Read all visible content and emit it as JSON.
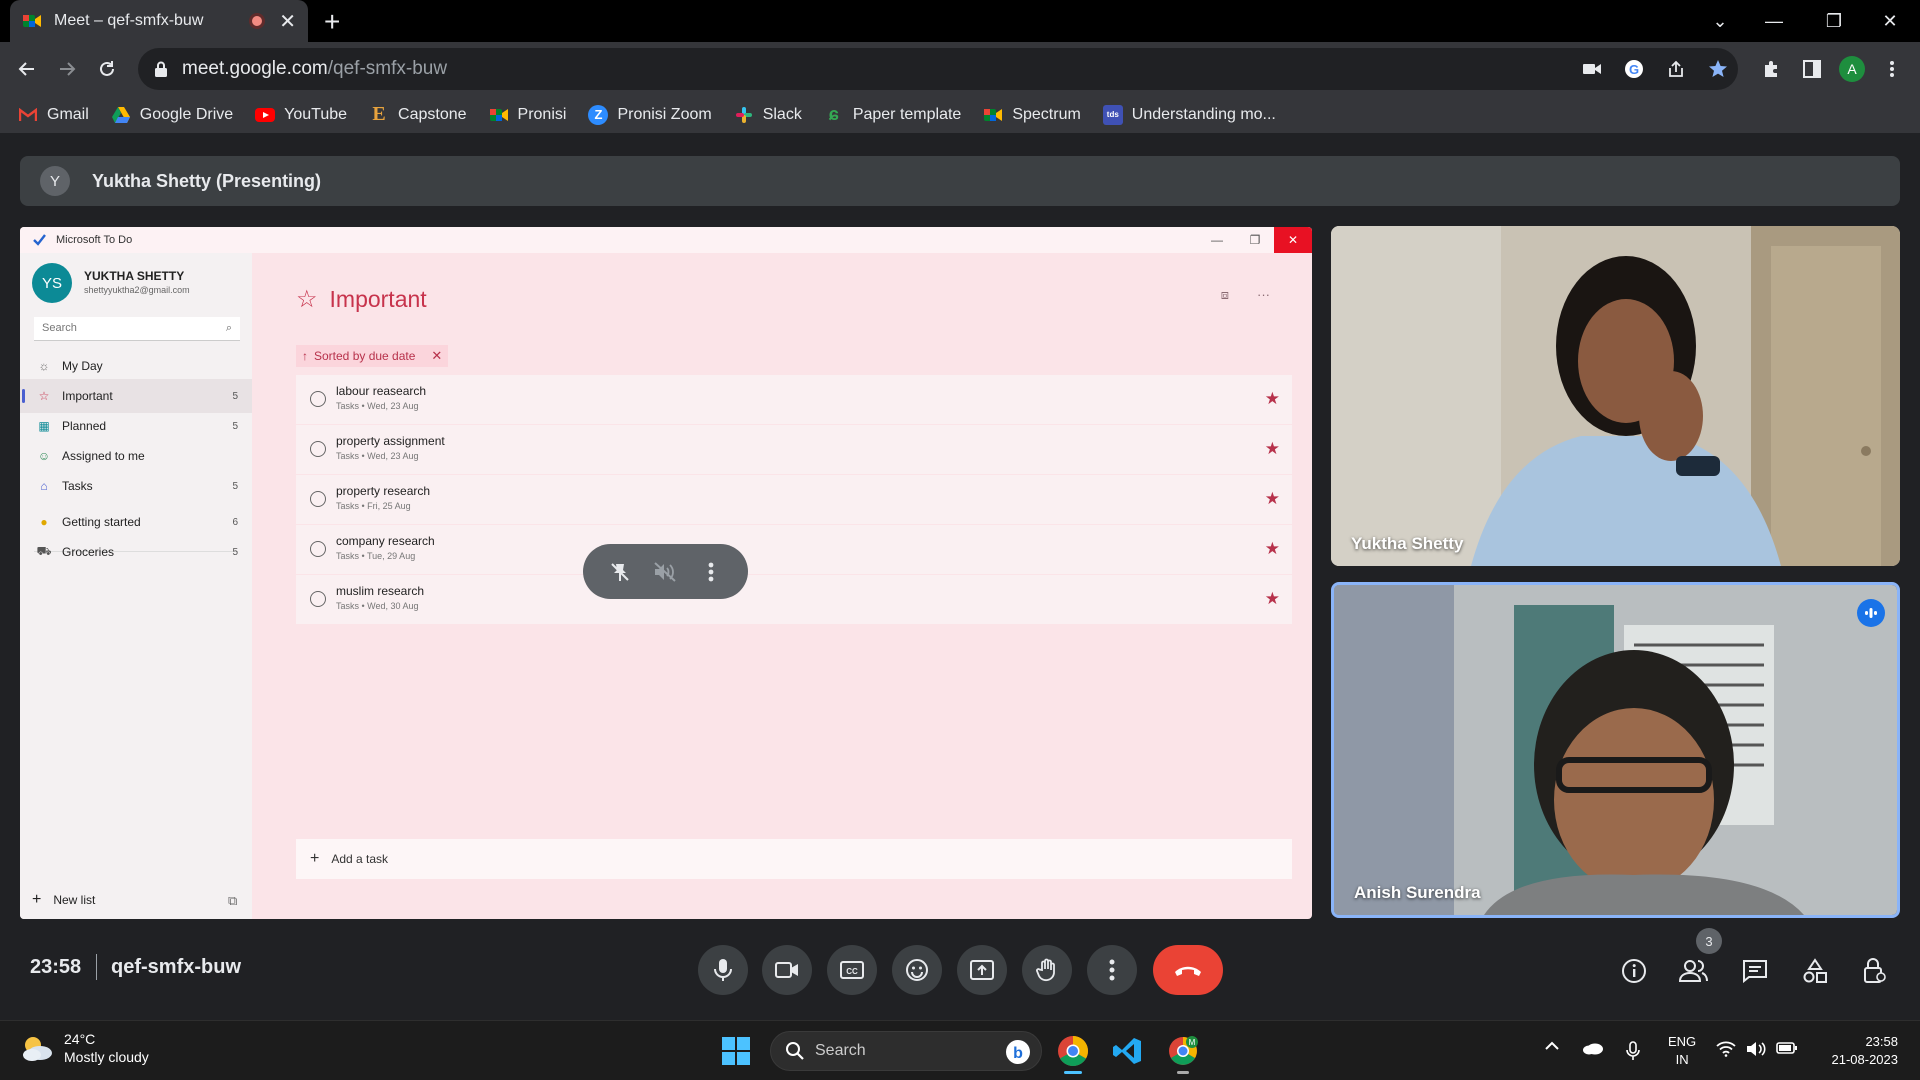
{
  "browser": {
    "tab_title": "Meet – qef-smfx-buw",
    "url_host": "meet.google.com",
    "url_path": "/qef-smfx-buw",
    "profile_initial": "A",
    "bookmarks": [
      "Gmail",
      "Google Drive",
      "YouTube",
      "Capstone",
      "Pronisi",
      "Pronisi Zoom",
      "Slack",
      "Paper template",
      "Spectrum",
      "Understanding mo..."
    ]
  },
  "meet": {
    "presenter_initial": "Y",
    "presenting_label": "Yuktha Shetty (Presenting)",
    "time": "23:58",
    "meeting_code": "qef-smfx-buw",
    "participants_count": "3",
    "tiles": [
      {
        "name": "Yuktha Shetty"
      },
      {
        "name": "Anish Surendra"
      }
    ]
  },
  "todo": {
    "app_name": "Microsoft To Do",
    "user_initials": "YS",
    "user_name": "YUKTHA SHETTY",
    "user_email": "shettyyuktha2@gmail.com",
    "search_placeholder": "Search",
    "lists": [
      {
        "label": "My Day",
        "count": ""
      },
      {
        "label": "Important",
        "count": "5"
      },
      {
        "label": "Planned",
        "count": "5"
      },
      {
        "label": "Assigned to me",
        "count": ""
      },
      {
        "label": "Tasks",
        "count": "5"
      },
      {
        "label": "Getting started",
        "count": "6"
      },
      {
        "label": "Groceries",
        "count": "5"
      }
    ],
    "new_list": "New list",
    "page_title": "Important",
    "sort_label": "Sorted by due date",
    "tasks": [
      {
        "name": "labour reasearch",
        "meta": "Tasks  •  Wed, 23 Aug"
      },
      {
        "name": "property assignment",
        "meta": "Tasks  •  Wed, 23 Aug"
      },
      {
        "name": "property research",
        "meta": "Tasks  •  Fri, 25 Aug"
      },
      {
        "name": "company research",
        "meta": "Tasks  •  Tue, 29 Aug"
      },
      {
        "name": "muslim research",
        "meta": "Tasks  •  Wed, 30 Aug"
      }
    ],
    "add_task": "Add a task"
  },
  "taskbar": {
    "temp": "24°C",
    "weather": "Mostly cloudy",
    "search": "Search",
    "lang_1": "ENG",
    "lang_2": "IN",
    "time": "23:58",
    "date": "21-08-2023"
  },
  "colors": {
    "accent_blue": "#8ab4f8",
    "end_call": "#ea4335",
    "todo_accent": "#c7334c"
  }
}
